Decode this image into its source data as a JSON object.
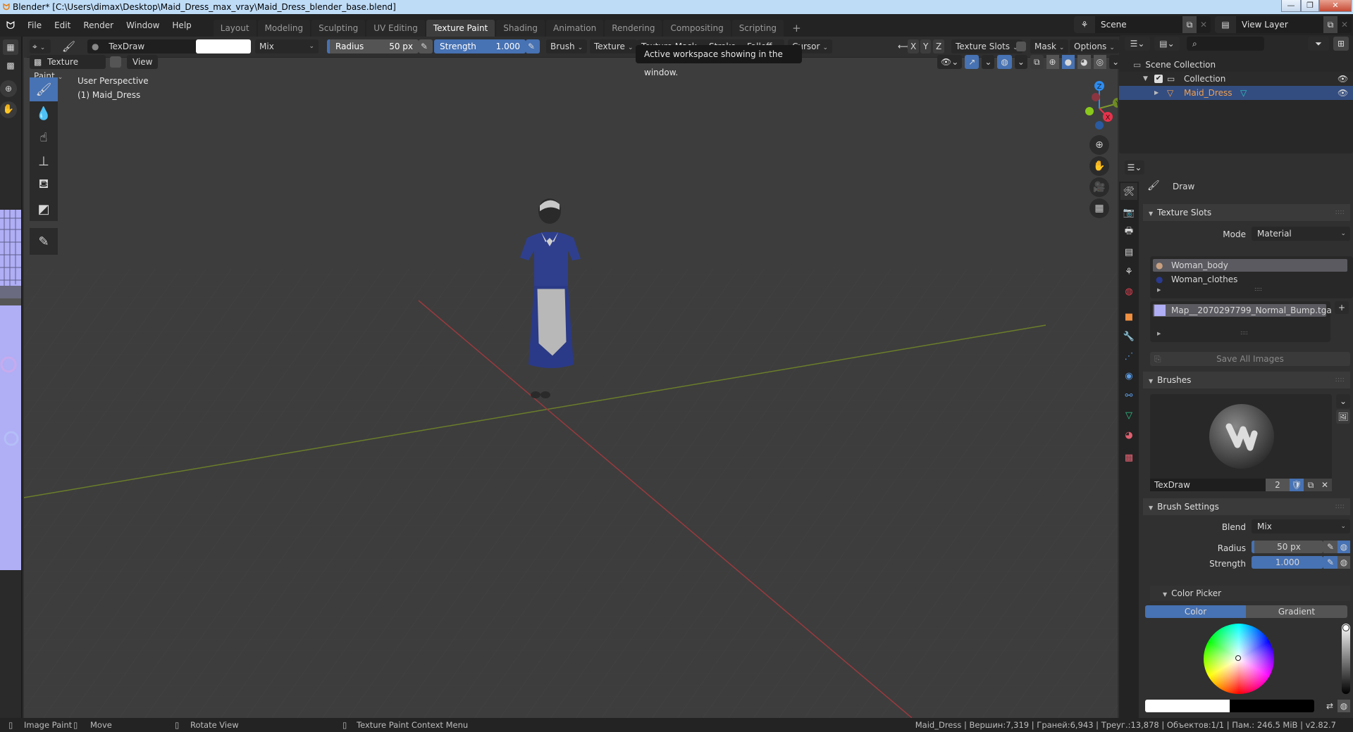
{
  "window": {
    "title": "Blender* [C:\\Users\\dimax\\Desktop\\Maid_Dress_max_vray\\Maid_Dress_blender_base.blend]",
    "minimize_glyph": "—",
    "maximize_glyph": "❐",
    "close_glyph": "✕"
  },
  "menu": [
    "File",
    "Edit",
    "Render",
    "Window",
    "Help"
  ],
  "workspaces": {
    "tabs": [
      "Layout",
      "Modeling",
      "Sculpting",
      "UV Editing",
      "Texture Paint",
      "Shading",
      "Animation",
      "Rendering",
      "Compositing",
      "Scripting"
    ],
    "active": "Texture Paint",
    "add_glyph": "+"
  },
  "scene": {
    "name": "Scene",
    "view_layer": "View Layer"
  },
  "tooltip": "Active workspace showing in the window.",
  "tool_header": {
    "brush_name": "TexDraw",
    "color_hex": "#ffffff",
    "blend": "Mix",
    "radius_label": "Radius",
    "radius_value": "50 px",
    "strength_label": "Strength",
    "strength_value": "1.000",
    "menus": [
      "Brush",
      "Texture",
      "Texture Mask",
      "Stroke",
      "Falloff",
      "Cursor"
    ],
    "mirror_axes": [
      "X",
      "Y",
      "Z"
    ],
    "texture_slots": "Texture Slots",
    "mask": "Mask",
    "options": "Options"
  },
  "viewport": {
    "mode": "Texture Paint",
    "view_menu": "View",
    "perspective": "User Perspective",
    "object_info": "(1) Maid_Dress",
    "gizmo_axes": {
      "x": "X",
      "y": "Y",
      "z": "Z"
    },
    "axis_colors": {
      "x": "#e8324c",
      "y": "#7d9a2c",
      "z": "#2d8cf0"
    },
    "tools": [
      "draw",
      "soften",
      "smear",
      "clone",
      "fill",
      "mask",
      "annotate"
    ]
  },
  "outliner": {
    "root": "Scene Collection",
    "collection": "Collection",
    "object": "Maid_Dress",
    "selected_color": "#334d80"
  },
  "properties": {
    "tool_name": "Draw",
    "texture_slots": {
      "title": "Texture Slots",
      "mode_label": "Mode",
      "mode_value": "Material",
      "materials": [
        "Woman_body",
        "Woman_clothes"
      ],
      "image": "Map__2070297799_Normal_Bump.tga",
      "save_all": "Save All Images"
    },
    "brushes": {
      "title": "Brushes",
      "name": "TexDraw",
      "users": "2"
    },
    "brush_settings": {
      "title": "Brush Settings",
      "blend_label": "Blend",
      "blend_value": "Mix",
      "radius_label": "Radius",
      "radius_value": "50 px",
      "strength_label": "Strength",
      "strength_value": "1.000",
      "strength_fraction": 1.0
    },
    "color_picker": {
      "title": "Color Picker",
      "tab_color": "Color",
      "tab_gradient": "Gradient",
      "primary": "#ffffff",
      "secondary": "#000000"
    }
  },
  "statusbar": {
    "left": [
      {
        "icon": "mouse-left",
        "label": "Image Paint"
      },
      {
        "icon": "mouse-move",
        "label": "Move"
      },
      {
        "icon": "mouse-middle",
        "label": "Rotate View"
      },
      {
        "icon": "mouse-right",
        "label": "Texture Paint Context Menu"
      }
    ],
    "stats": "Maid_Dress | Вершин:7,319 | Граней:6,943 | Треуг.:13,878 | Объектов:1/1 | Пам.: 246.5 MiB | v2.82.7"
  }
}
